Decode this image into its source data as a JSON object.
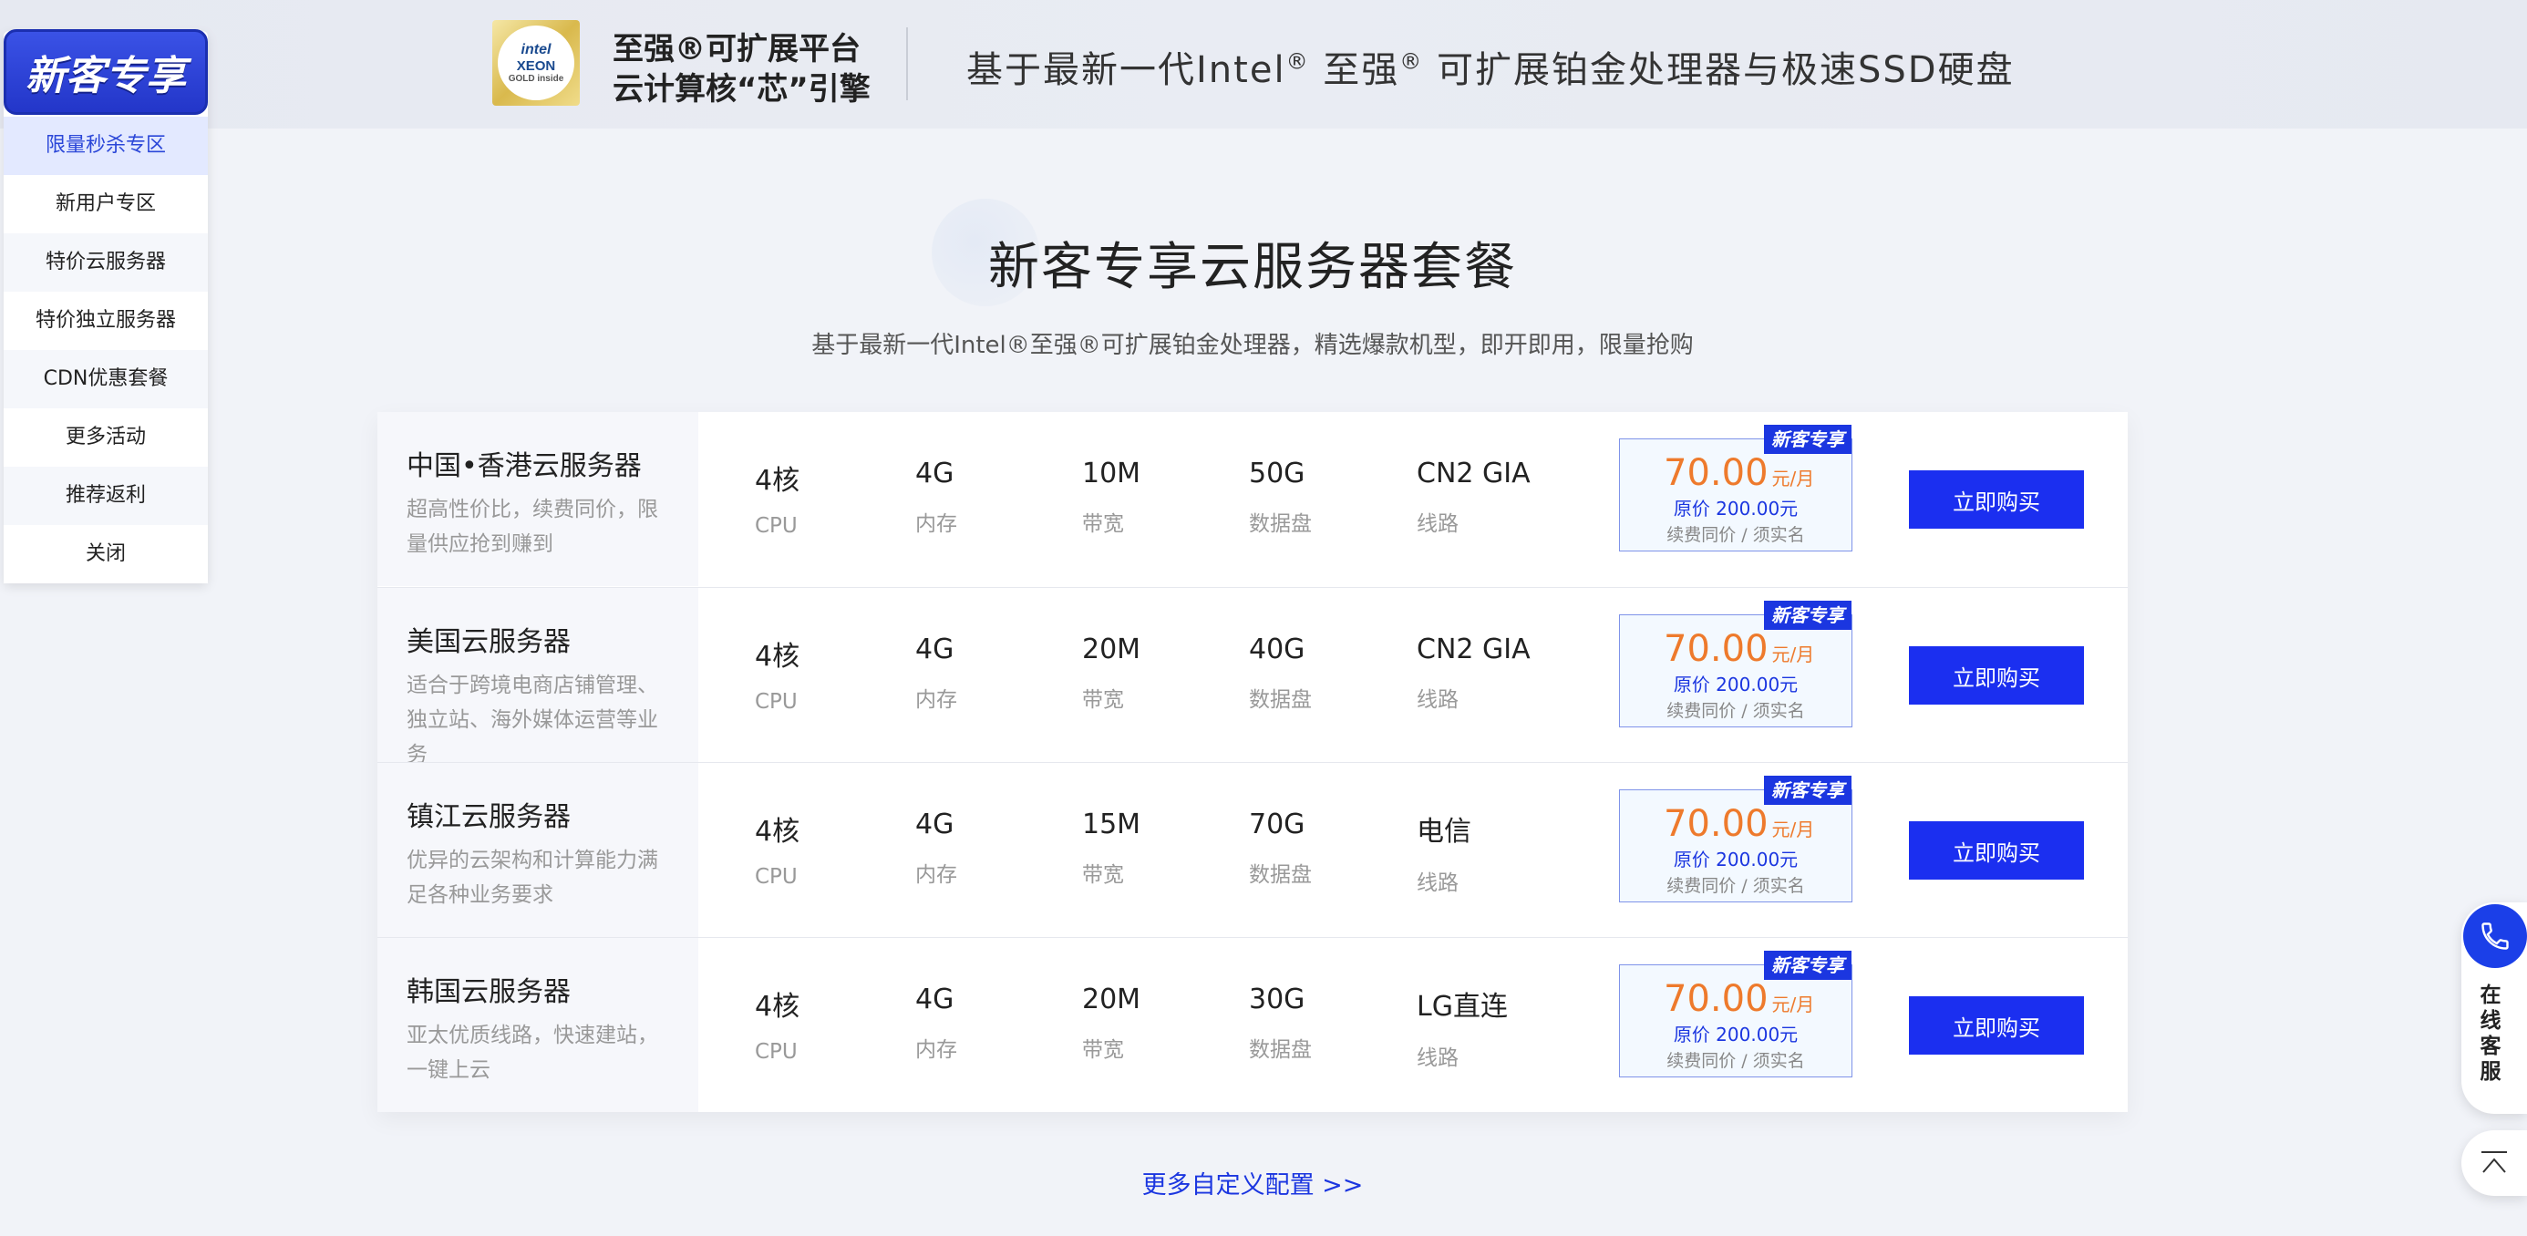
{
  "banner": {
    "chip": {
      "l1": "intel",
      "l2": "XEON",
      "l3": "GOLD inside"
    },
    "line1": "至强®可扩展平台",
    "line2": "云计算核“芯”引擎",
    "slogan_a": "基于最新一代Intel",
    "slogan_reg1": "®",
    "slogan_b": " 至强",
    "slogan_reg2": "®",
    "slogan_c": " 可扩展铂金处理器与极速SSD硬盘"
  },
  "side_menu": {
    "badge": "新客专享",
    "items": [
      {
        "label": "限量秒杀专区",
        "active": true
      },
      {
        "label": "新用户专区"
      },
      {
        "label": "特价云服务器"
      },
      {
        "label": "特价独立服务器"
      },
      {
        "label": "CDN优惠套餐"
      },
      {
        "label": "更多活动"
      },
      {
        "label": "推荐返利"
      },
      {
        "label": "关闭"
      }
    ]
  },
  "section": {
    "title": "新客专享云服务器套餐",
    "subtitle": "基于最新一代Intel®至强®可扩展铂金处理器，精选爆款机型，即开即用，限量抢购"
  },
  "spec_labels": {
    "cpu": "CPU",
    "mem": "内存",
    "bw": "带宽",
    "disk": "数据盘",
    "line": "线路"
  },
  "rows": [
    {
      "name": "中国•香港云服务器",
      "desc": "超高性价比，续费同价，限量供应抢到赚到",
      "cpu": "4核",
      "mem": "4G",
      "bw": "10M",
      "disk": "50G",
      "line": "CN2 GIA",
      "tag": "新客专享",
      "price": "70.00",
      "unit": "元/月",
      "orig": "原价 200.00元",
      "note": "续费同价 / 须实名",
      "btn": "立即购买"
    },
    {
      "name": "美国云服务器",
      "desc": "适合于跨境电商店铺管理、独立站、海外媒体运营等业务",
      "cpu": "4核",
      "mem": "4G",
      "bw": "20M",
      "disk": "40G",
      "line": "CN2 GIA",
      "tag": "新客专享",
      "price": "70.00",
      "unit": "元/月",
      "orig": "原价 200.00元",
      "note": "续费同价 / 须实名",
      "btn": "立即购买"
    },
    {
      "name": "镇江云服务器",
      "desc": "优异的云架构和计算能力满足各种业务要求",
      "cpu": "4核",
      "mem": "4G",
      "bw": "15M",
      "disk": "70G",
      "line": "电信",
      "tag": "新客专享",
      "price": "70.00",
      "unit": "元/月",
      "orig": "原价 200.00元",
      "note": "续费同价 / 须实名",
      "btn": "立即购买"
    },
    {
      "name": "韩国云服务器",
      "desc": "亚太优质线路，快速建站，一键上云",
      "cpu": "4核",
      "mem": "4G",
      "bw": "20M",
      "disk": "30G",
      "line": "LG直连",
      "tag": "新客专享",
      "price": "70.00",
      "unit": "元/月",
      "orig": "原价 200.00元",
      "note": "续费同价 / 须实名",
      "btn": "立即购买"
    }
  ],
  "more_link": "更多自定义配置 >>",
  "float_service": {
    "chars": [
      "在",
      "线",
      "客",
      "服"
    ]
  },
  "colors": {
    "accent": "#1b2ff0",
    "price": "#ee7a2c",
    "tag": "#1b36e0"
  }
}
